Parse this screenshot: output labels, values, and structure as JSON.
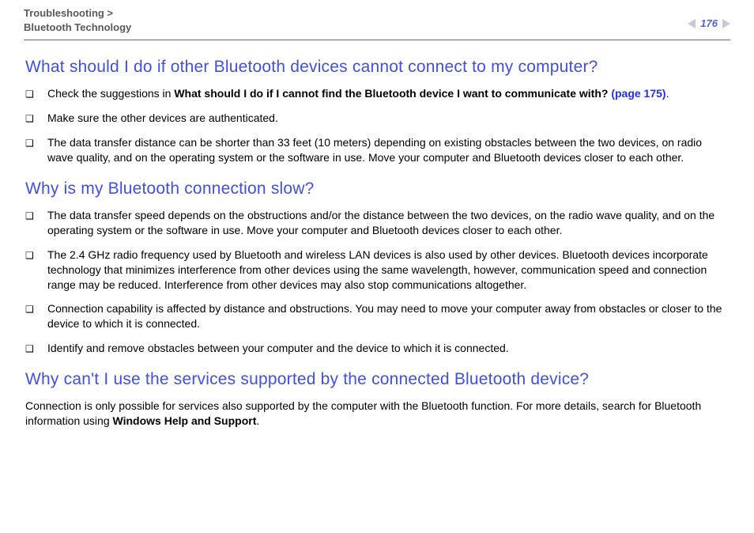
{
  "header": {
    "breadcrumb_line1": "Troubleshooting >",
    "breadcrumb_line2": "Bluetooth Technology",
    "page_number": "176"
  },
  "sections": {
    "s1": {
      "title": "What should I do if other Bluetooth devices cannot connect to my computer?",
      "b0_pre": "Check the suggestions in ",
      "b0_boldpart": "What should I do if I cannot find the Bluetooth device I want to communicate with? ",
      "b0_linkpart": "(page 175)",
      "b0_post": ".",
      "b1": "Make sure the other devices are authenticated.",
      "b2": "The data transfer distance can be shorter than 33 feet (10 meters) depending on existing obstacles between the two devices, on radio wave quality, and on the operating system or the software in use. Move your computer and Bluetooth devices closer to each other."
    },
    "s2": {
      "title": "Why is my Bluetooth connection slow?",
      "b0": "The data transfer speed depends on the obstructions and/or the distance between the two devices, on the radio wave quality, and on the operating system or the software in use. Move your computer and Bluetooth devices closer to each other.",
      "b1": "The 2.4 GHz radio frequency used by Bluetooth and wireless LAN devices is also used by other devices. Bluetooth devices incorporate technology that minimizes interference from other devices using the same wavelength, however, communication speed and connection range may be reduced. Interference from other devices may also stop communications altogether.",
      "b2": "Connection capability is affected by distance and obstructions. You may need to move your computer away from obstacles or closer to the device to which it is connected.",
      "b3": "Identify and remove obstacles between your computer and the device to which it is connected."
    },
    "s3": {
      "title": "Why can't I use the services supported by the connected Bluetooth device?",
      "p_pre": "Connection is only possible for services also supported by the computer with the Bluetooth function. For more details, search for Bluetooth information using ",
      "p_bold": "Windows Help and Support",
      "p_post": "."
    }
  },
  "glyphs": {
    "bullet": "❑"
  }
}
